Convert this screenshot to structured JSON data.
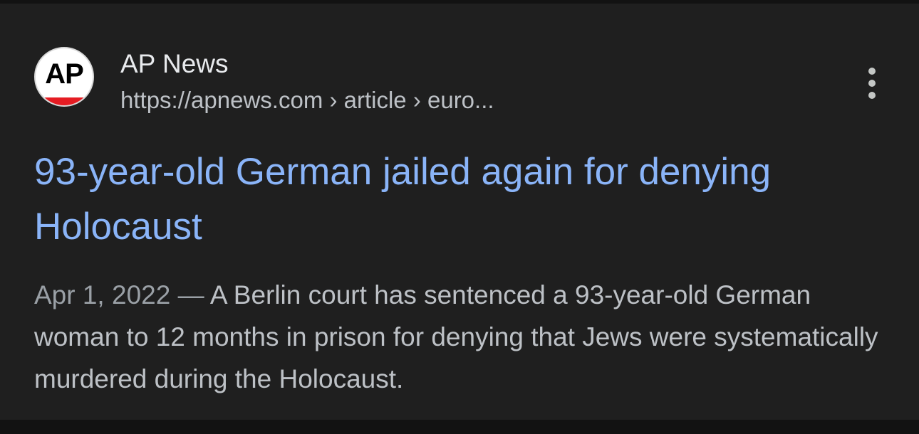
{
  "result": {
    "source": {
      "favicon_text": "AP",
      "favicon_icon": "ap-logo-icon",
      "site_name": "AP News",
      "url": "https://apnews.com › article › euro..."
    },
    "more_icon": "more-vert-icon",
    "title": "93-year-old German jailed again for denying Holocaust",
    "snippet": {
      "date": "Apr 1, 2022",
      "separator": " — ",
      "text": "A Berlin court has sentenced a 93-year-old German woman to 12 months in prison for denying that Jews were systematically murdered during the Holocaust."
    }
  },
  "colors": {
    "background": "#1f1f1f",
    "title_link": "#8ab4f8",
    "site_name": "#e8eaed",
    "body_text": "#bdc1c6",
    "date_text": "#9aa0a6",
    "favicon_bar": "#e51c23"
  }
}
